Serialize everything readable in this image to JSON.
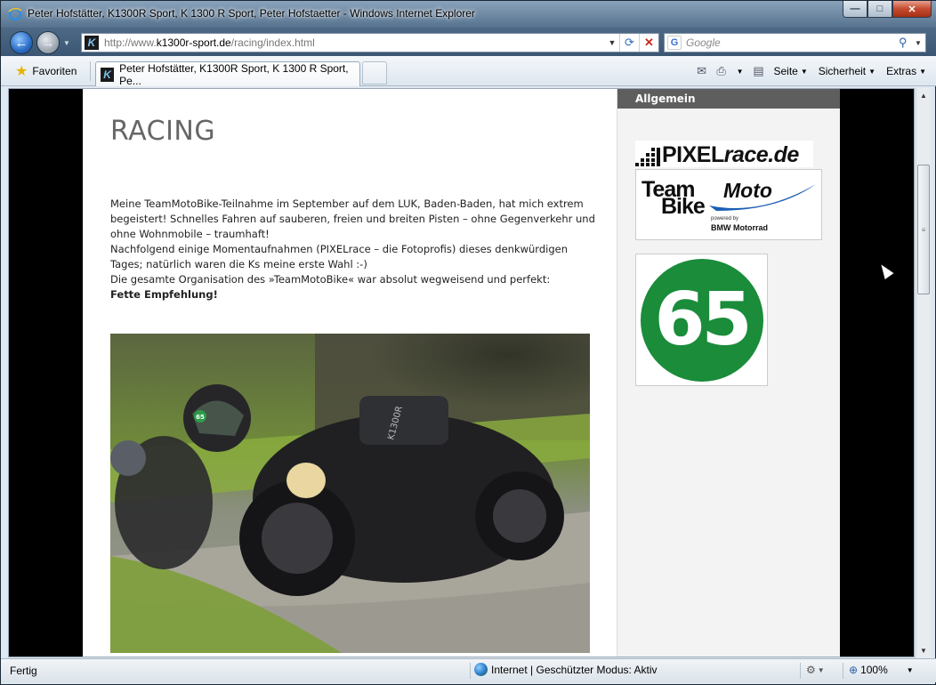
{
  "window": {
    "title": "Peter Hofstätter, K1300R Sport, K 1300 R Sport, Peter Hofstaetter - Windows Internet Explorer",
    "min_label": "—",
    "max_label": "□",
    "close_label": "✕"
  },
  "nav": {
    "back_glyph": "←",
    "fwd_glyph": "→",
    "address_prefix": "http://www.",
    "address_domain": "k1300r-sport.de",
    "address_path": "/racing/index.html",
    "search_placeholder": "Google"
  },
  "toolbar": {
    "favorites_label": "Favoriten",
    "tab_title": "Peter Hofstätter, K1300R Sport, K 1300 R Sport, Pe...",
    "page_label": "Seite",
    "security_label": "Sicherheit",
    "extras_label": "Extras"
  },
  "page": {
    "heading": "RACING",
    "paragraphs": [
      "Meine TeamMotoBike-Teilnahme im September auf dem LUK, Baden-Baden, hat mich extrem begeistert! Schnelles Fahren auf sauberen, freien und breiten Pisten – ohne Gegenverkehr und ohne Wohnmobile – traumhaft!",
      "Nachfolgend einige Momentaufnahmen (PIXELrace – die Fotoprofis) dieses denkwürdigen Tages; natürlich waren die Ks meine erste Wahl :-)",
      "Die gesamte Organisation des »TeamMotoBike« war absolut wegweisend und perfekt:"
    ],
    "emphasis": "Fette Empfehlung!",
    "photo_bike_label": "K1300R",
    "helmet_number": "65"
  },
  "sidebar": {
    "heading": "Allgemein",
    "pixelrace_logo": {
      "main": "PIXEL",
      "italic": "race.de"
    },
    "teammotobike_logo": {
      "team": "Team",
      "moto": "Moto",
      "bike": "Bike",
      "powered": "powered by",
      "sponsor": "BMW Motorrad"
    },
    "badge_number": "65"
  },
  "status": {
    "left": "Fertig",
    "zone": "Internet | Geschützter Modus: Aktiv",
    "zoom": "100%"
  },
  "colors": {
    "sidebar_header": "#5e5e5e",
    "badge_green": "#1a8c3a"
  }
}
